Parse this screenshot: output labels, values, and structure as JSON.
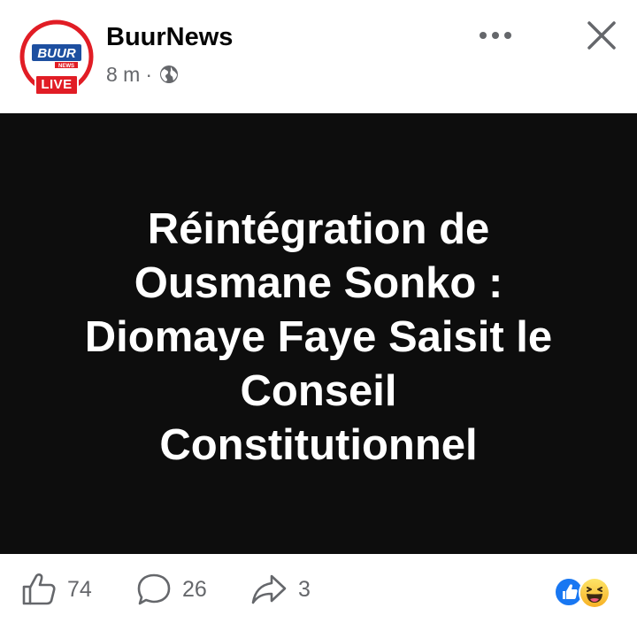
{
  "post": {
    "page_name": "BuurNews",
    "timestamp": "8 m",
    "separator": "·",
    "audience_icon": "globe-icon",
    "avatar": {
      "logo_text": "BUUR",
      "logo_subtext": "NEWS",
      "live_badge": "LIVE"
    },
    "headline_lines": [
      "Réintégration de",
      "Ousmane Sonko :",
      "Diomaye Faye Saisit le",
      "Conseil",
      "Constitutionnel"
    ]
  },
  "actions": {
    "like_count": "74",
    "comment_count": "26",
    "share_count": "3",
    "reactions": [
      "like-reaction-icon",
      "haha-reaction-icon"
    ]
  },
  "colors": {
    "brand_red": "#e11d25",
    "brand_blue": "#1d4fa0",
    "facebook_blue": "#1877f2",
    "card_background": "#0d0d0d",
    "secondary_text": "#65676b"
  }
}
